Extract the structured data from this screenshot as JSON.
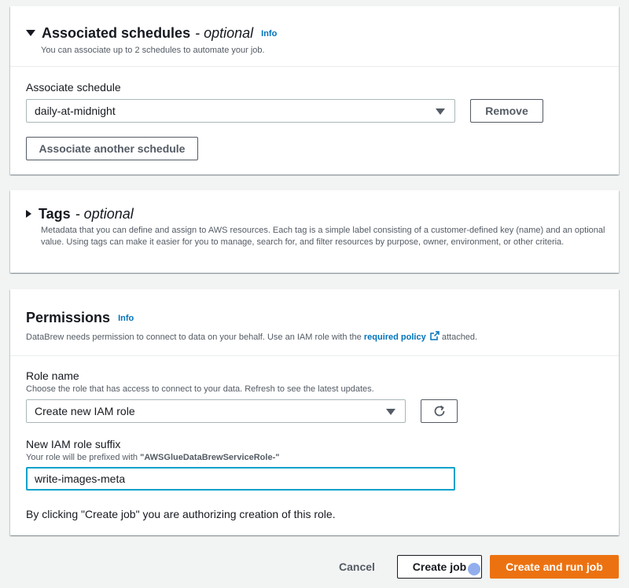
{
  "schedules": {
    "title": "Associated schedules",
    "optional": "- optional",
    "info": "Info",
    "description": "You can associate up to 2 schedules to automate your job.",
    "field_label": "Associate schedule",
    "selected_value": "daily-at-midnight",
    "remove_label": "Remove",
    "associate_another_label": "Associate another schedule"
  },
  "tags": {
    "title": "Tags",
    "optional": "- optional",
    "description": "Metadata that you can define and assign to AWS resources. Each tag is a simple label consisting of a customer-defined key (name) and an optional value. Using tags can make it easier for you to manage, search for, and filter resources by purpose, owner, environment, or other criteria."
  },
  "permissions": {
    "title": "Permissions",
    "info": "Info",
    "description_prefix": "DataBrew needs permission to connect to data on your behalf. Use an IAM role with the",
    "policy_link": "required policy",
    "description_suffix": "attached.",
    "role_label": "Role name",
    "role_description": "Choose the role that has access to connect to your data. Refresh to see the latest updates.",
    "role_value": "Create new IAM role",
    "suffix_label": "New IAM role suffix",
    "suffix_description_prefix": "Your role will be prefixed with",
    "suffix_prefix_value": "\"AWSGlueDataBrewServiceRole-\"",
    "suffix_value": "write-images-meta",
    "authorize_note": "By clicking \"Create job\" you are authorizing creation of this role."
  },
  "footer": {
    "cancel_label": "Cancel",
    "create_label": "Create job",
    "create_run_label": "Create and run job"
  },
  "colors": {
    "link": "#0073bb",
    "primary": "#ec7211",
    "focus": "#00a1c9"
  }
}
